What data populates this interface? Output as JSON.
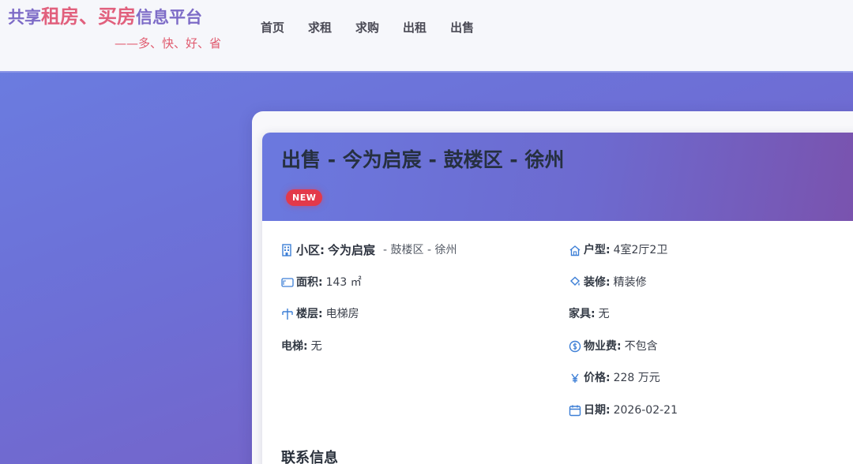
{
  "header": {
    "logo": {
      "part1": "共享",
      "part2": "租房",
      "part3": "、",
      "part4": "买房",
      "part5": "信息平台",
      "slogan": "——多、快、好、省"
    },
    "nav": [
      "首页",
      "求租",
      "求购",
      "出租",
      "出售"
    ]
  },
  "listing": {
    "title": "出售 - 今为启宸 - 鼓楼区 - 徐州",
    "badge": "NEW",
    "left": {
      "community_label": "小区:",
      "community_value": "今为启宸",
      "community_sub": "- 鼓楼区 - 徐州",
      "area_label": "面积:",
      "area_value": "143 ㎡",
      "floor_label": "楼层:",
      "floor_value": "电梯房",
      "elevator_label": "电梯:",
      "elevator_value": "无"
    },
    "right": {
      "layout_label": "户型:",
      "layout_value": "4室2厅2卫",
      "decoration_label": "装修:",
      "decoration_value": "精装修",
      "furniture_label": "家具:",
      "furniture_value": "无",
      "fee_label": "物业费:",
      "fee_value": "不包含",
      "price_label": "价格:",
      "price_value": "228 万元",
      "date_label": "日期:",
      "date_value": "2026-02-21"
    },
    "contact_title": "联系信息"
  },
  "icons": {
    "community": "building-icon",
    "area": "area-icon",
    "floor": "floor-icon",
    "layout": "house-icon",
    "decoration": "paint-bucket-icon",
    "fee": "coin-icon",
    "price": "yen-icon",
    "date": "calendar-icon"
  },
  "colors": {
    "accent": "#6b79df",
    "icon_blue": "#3d7fd6",
    "badge_red": "#e3394a",
    "logo_purple": "#7d6bc7",
    "logo_pink": "#e1607d"
  }
}
